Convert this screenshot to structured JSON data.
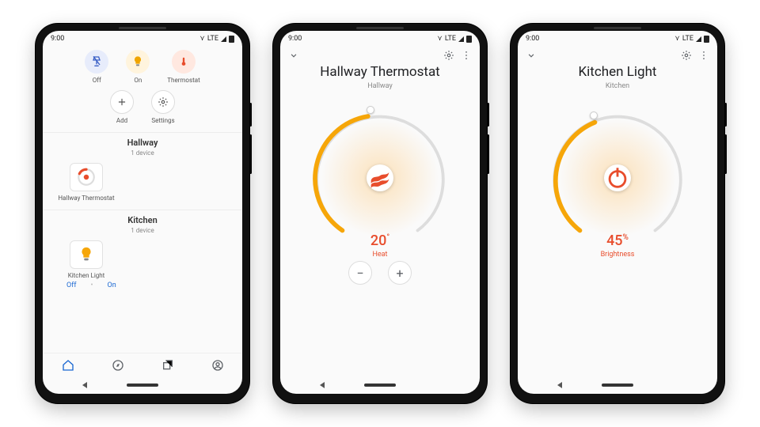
{
  "status": {
    "time": "9:00",
    "lte": "LTE"
  },
  "home": {
    "chips": [
      {
        "key": "off",
        "label": "Off",
        "icon": "lamp-off"
      },
      {
        "key": "on",
        "label": "On",
        "icon": "bulb-on"
      },
      {
        "key": "thermostat",
        "label": "Thermostat",
        "icon": "thermometer"
      },
      {
        "key": "add",
        "label": "Add",
        "icon": "plus"
      },
      {
        "key": "settings",
        "label": "Settings",
        "icon": "gear"
      }
    ],
    "rooms": [
      {
        "name": "Hallway",
        "device_count": "1 device",
        "devices": [
          {
            "name": "Hallway Thermostat",
            "icon": "thermostat-dial"
          }
        ]
      },
      {
        "name": "Kitchen",
        "device_count": "1 device",
        "devices": [
          {
            "name": "Kitchen Light",
            "icon": "light-bulb"
          }
        ],
        "quick": {
          "off": "Off",
          "on": "On"
        }
      }
    ],
    "bottom_nav": [
      "home",
      "compass",
      "library",
      "account"
    ]
  },
  "thermostat": {
    "title": "Hallway Thermostat",
    "room": "Hallway",
    "value": "20",
    "unit": "°",
    "mode": "Heat",
    "minus": "−",
    "plus": "+"
  },
  "light": {
    "title": "Kitchen Light",
    "room": "Kitchen",
    "value": "45",
    "unit": "%",
    "mode": "Brightness"
  },
  "colors": {
    "accent": "#e84d2c",
    "blue": "#1967d2",
    "amber": "#f6a609"
  }
}
